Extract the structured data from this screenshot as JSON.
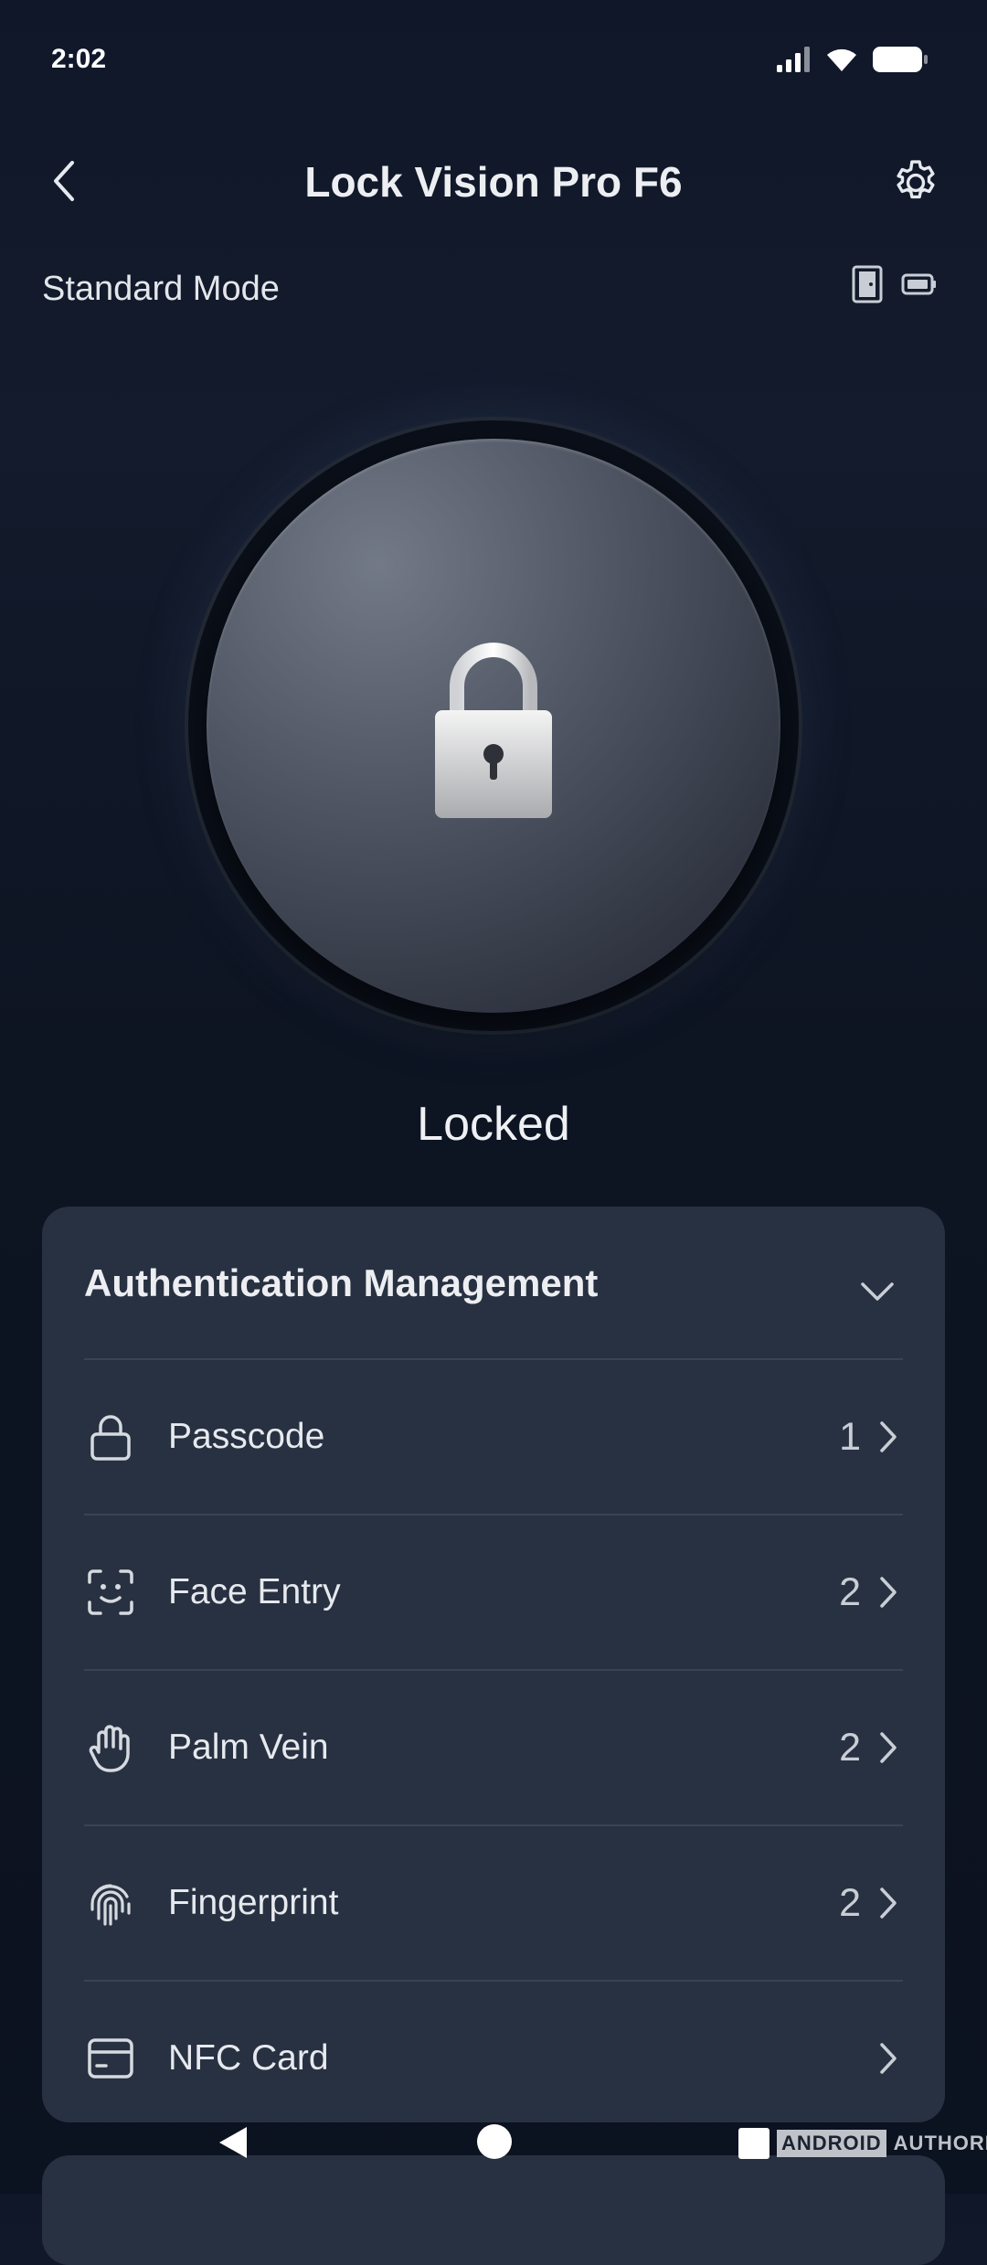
{
  "status_bar": {
    "time": "2:02",
    "icons": [
      "signal-icon",
      "wifi-icon",
      "battery-icon"
    ]
  },
  "header": {
    "title": "Lock Vision Pro F6",
    "back_icon": "chevron-left-icon",
    "settings_icon": "gear-icon"
  },
  "mode": {
    "label": "Standard Mode",
    "icons": [
      "door-icon",
      "battery-icon"
    ]
  },
  "lock": {
    "icon": "padlock-icon",
    "status": "Locked"
  },
  "auth": {
    "title": "Authentication Management",
    "toggle_icon": "chevron-down-icon",
    "items": [
      {
        "label": "Passcode",
        "count": "1",
        "icon": "lock-outline-icon"
      },
      {
        "label": "Face Entry",
        "count": "2",
        "icon": "face-scan-icon"
      },
      {
        "label": "Palm Vein",
        "count": "2",
        "icon": "palm-icon"
      },
      {
        "label": "Fingerprint",
        "count": "2",
        "icon": "fingerprint-icon"
      },
      {
        "label": "NFC Card",
        "count": "",
        "icon": "card-icon"
      }
    ]
  },
  "watermark": {
    "part1": "ANDROID",
    "part2": "AUTHORITY"
  },
  "colors": {
    "background": "#0f1729",
    "card": "#283141",
    "divider": "#3a4352",
    "text": "#e6e9ee"
  }
}
